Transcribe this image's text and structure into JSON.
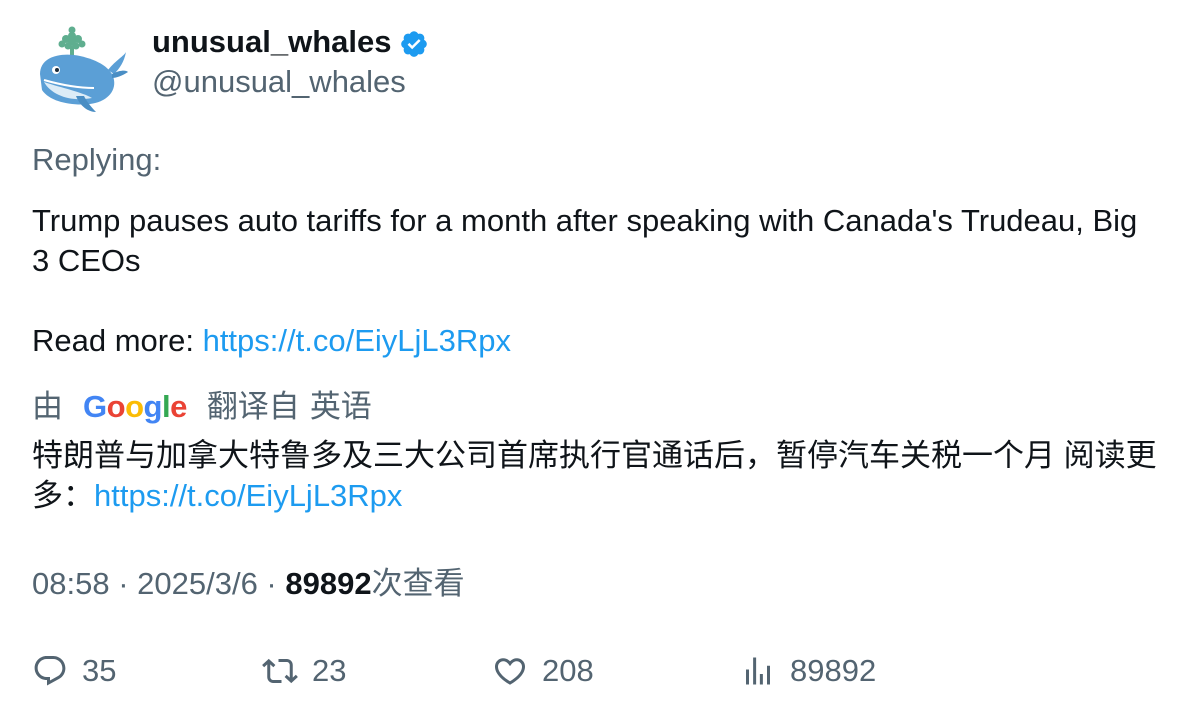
{
  "author": {
    "display_name": "unusual_whales",
    "handle": "@unusual_whales",
    "verified": true,
    "avatar_icon": "whale-avatar-icon"
  },
  "tweet": {
    "replying_label": "Replying:",
    "text_line1": "Trump pauses auto tariffs for a month after speaking with Canada's Trudeau, Big 3 CEOs",
    "read_more_label": "Read more: ",
    "link": "https://t.co/EiyLjL3Rpx"
  },
  "translation": {
    "by_label": "由",
    "provider": "Google",
    "translated_from_label": "翻译自",
    "source_language": "英语",
    "text": "特朗普与加拿大特鲁多及三大公司首席执行官通话后，暂停汽车关税一个月 阅读更多：",
    "link": "https://t.co/EiyLjL3Rpx"
  },
  "meta": {
    "time": "08:58",
    "separator": " · ",
    "date": "2025/3/6",
    "views_count": "89892",
    "views_label": "次查看"
  },
  "actions": {
    "replies": "35",
    "retweets": "23",
    "likes": "208",
    "views": "89892"
  },
  "colors": {
    "link": "#1d9bf0",
    "secondary_text": "#536471",
    "primary_text": "#0f1419",
    "verified_badge": "#1d9bf0"
  }
}
